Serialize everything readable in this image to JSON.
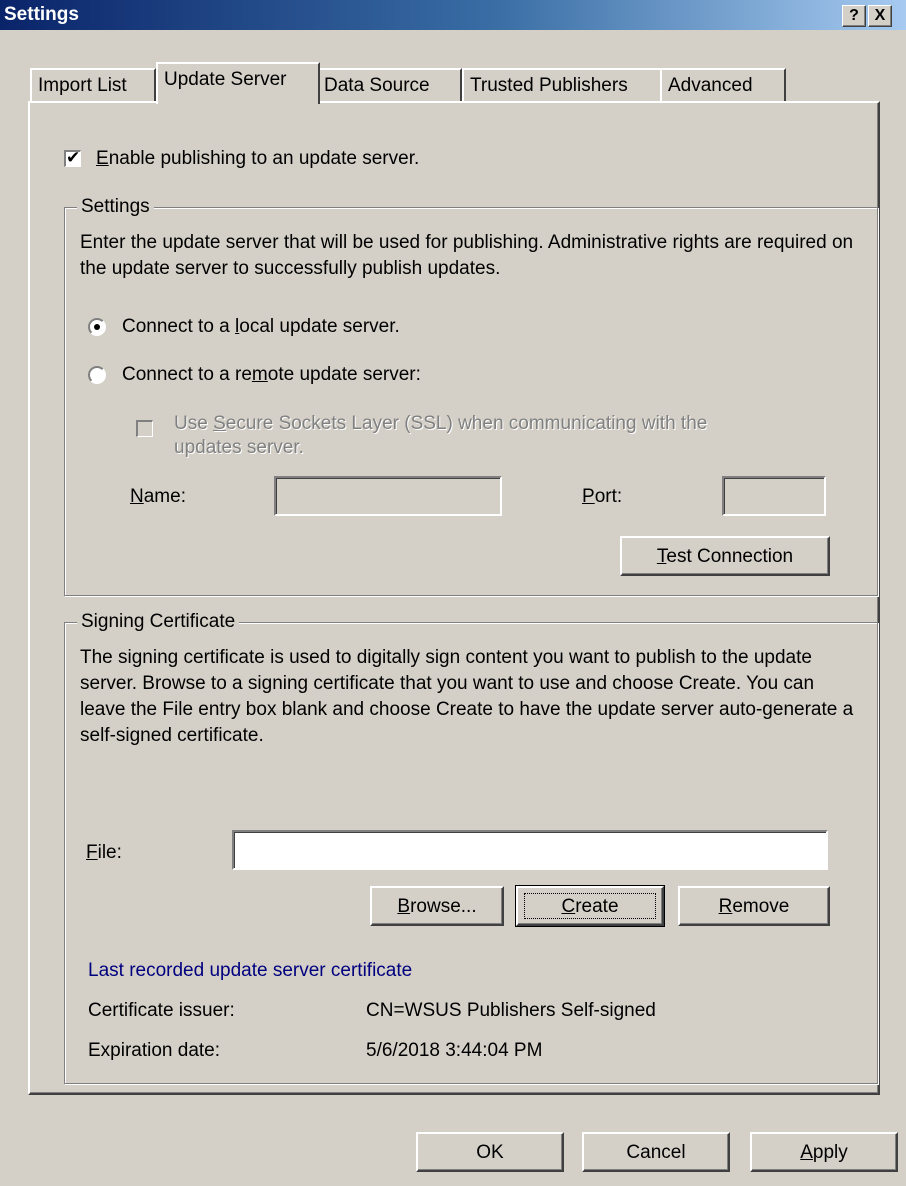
{
  "window": {
    "title": "Settings",
    "help_glyph": "?",
    "close_glyph": "X"
  },
  "tabs": [
    {
      "label": "Import List"
    },
    {
      "label": "Update Server"
    },
    {
      "label": "Data Source"
    },
    {
      "label": "Trusted Publishers"
    },
    {
      "label": "Advanced"
    }
  ],
  "update_server": {
    "enable_checkbox": {
      "checked": true,
      "label_access": "E",
      "label_rest": "nable publishing to an update server."
    },
    "settings_group": {
      "legend": "Settings",
      "description": "Enter the update server that will be used for publishing.  Administrative rights are required on the update server to successfully publish updates.",
      "radio_local": {
        "selected": true,
        "pre": "Connect to a ",
        "access": "l",
        "post": "ocal update server."
      },
      "radio_remote": {
        "selected": false,
        "pre": "Connect to a re",
        "access": "m",
        "post": "ote update server:"
      },
      "ssl_checkbox": {
        "checked": false,
        "pre": "Use ",
        "access": "S",
        "post": "ecure Sockets Layer (SSL) when communicating with the",
        "line2": "updates server."
      },
      "name_label": {
        "access": "N",
        "rest": "ame:"
      },
      "name_value": "",
      "port_label": {
        "access": "P",
        "rest": "ort:"
      },
      "port_value": "",
      "test_button": {
        "access": "T",
        "rest": "est Connection"
      }
    },
    "signing_group": {
      "legend": "Signing Certificate",
      "description": "The signing certificate is used to digitally sign content you want to publish to the update server. Browse to a signing certificate that you want to use and choose Create. You can leave the File entry box blank and choose Create to have the update server auto-generate a self-signed certificate.",
      "file_label": {
        "access": "F",
        "rest": "ile:"
      },
      "file_value": "",
      "browse_button": {
        "access": "B",
        "rest": "rowse..."
      },
      "create_button": {
        "access": "C",
        "rest": "reate"
      },
      "remove_button": {
        "access": "R",
        "rest": "emove"
      },
      "last_recorded_link": "Last recorded update server certificate",
      "issuer_label": "Certificate issuer:",
      "issuer_value": "CN=WSUS Publishers Self-signed",
      "expiration_label": "Expiration date:",
      "expiration_value": "5/6/2018 3:44:04 PM"
    }
  },
  "footer": {
    "ok": "OK",
    "cancel": "Cancel",
    "apply": {
      "access": "A",
      "rest": "pply"
    }
  }
}
